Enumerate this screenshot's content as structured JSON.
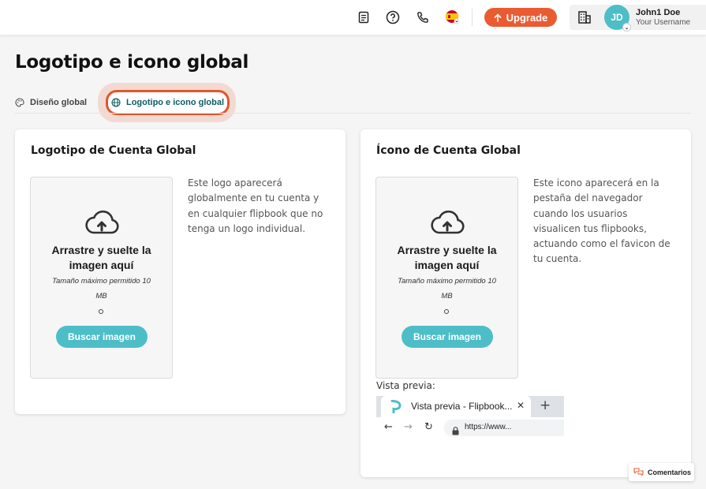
{
  "header": {
    "icons": [
      "document-icon",
      "help-icon",
      "phone-icon",
      "flag-es-icon",
      "building-icon"
    ],
    "upgrade_label": "Upgrade",
    "user": {
      "initials": "JD",
      "name": "John1 Doe",
      "username": "Your Username"
    }
  },
  "page": {
    "title": "Logotipo e icono global",
    "tabs": [
      {
        "label": "Diseño global",
        "icon": "palette-icon",
        "active": false
      },
      {
        "label": "Logotipo e icono global",
        "icon": "globe-icon",
        "active": true
      }
    ]
  },
  "logo_card": {
    "title": "Logotipo de Cuenta Global",
    "drop_title": "Arrastre y suelte la imagen aquí",
    "max_size": "Tamaño máximo permitido 10 MB",
    "button": "Buscar imagen",
    "description": "Este logo aparecerá globalmente en tu cuenta y en cualquier flipbook que no tenga un logo individual."
  },
  "icon_card": {
    "title": "Ícono de Cuenta Global",
    "drop_title": "Arrastre y suelte la imagen aquí",
    "max_size": "Tamaño máximo permitido 10 MB",
    "button": "Buscar imagen",
    "description": "Este icono aparecerá en la pestaña del navegador cuando los usuarios visualicen tus flipbooks, actuando como el favicon de tu cuenta.",
    "preview_label": "Vista previa:",
    "browser": {
      "tab_title": "Vista previa - Flipbook...",
      "close": "✕",
      "new_tab": "+",
      "url": "https://www..."
    }
  },
  "feedback_label": "Comentarios",
  "colors": {
    "accent": "#ea5b32",
    "teal": "#4dbec8",
    "active_tab_text": "#0f5c66"
  }
}
